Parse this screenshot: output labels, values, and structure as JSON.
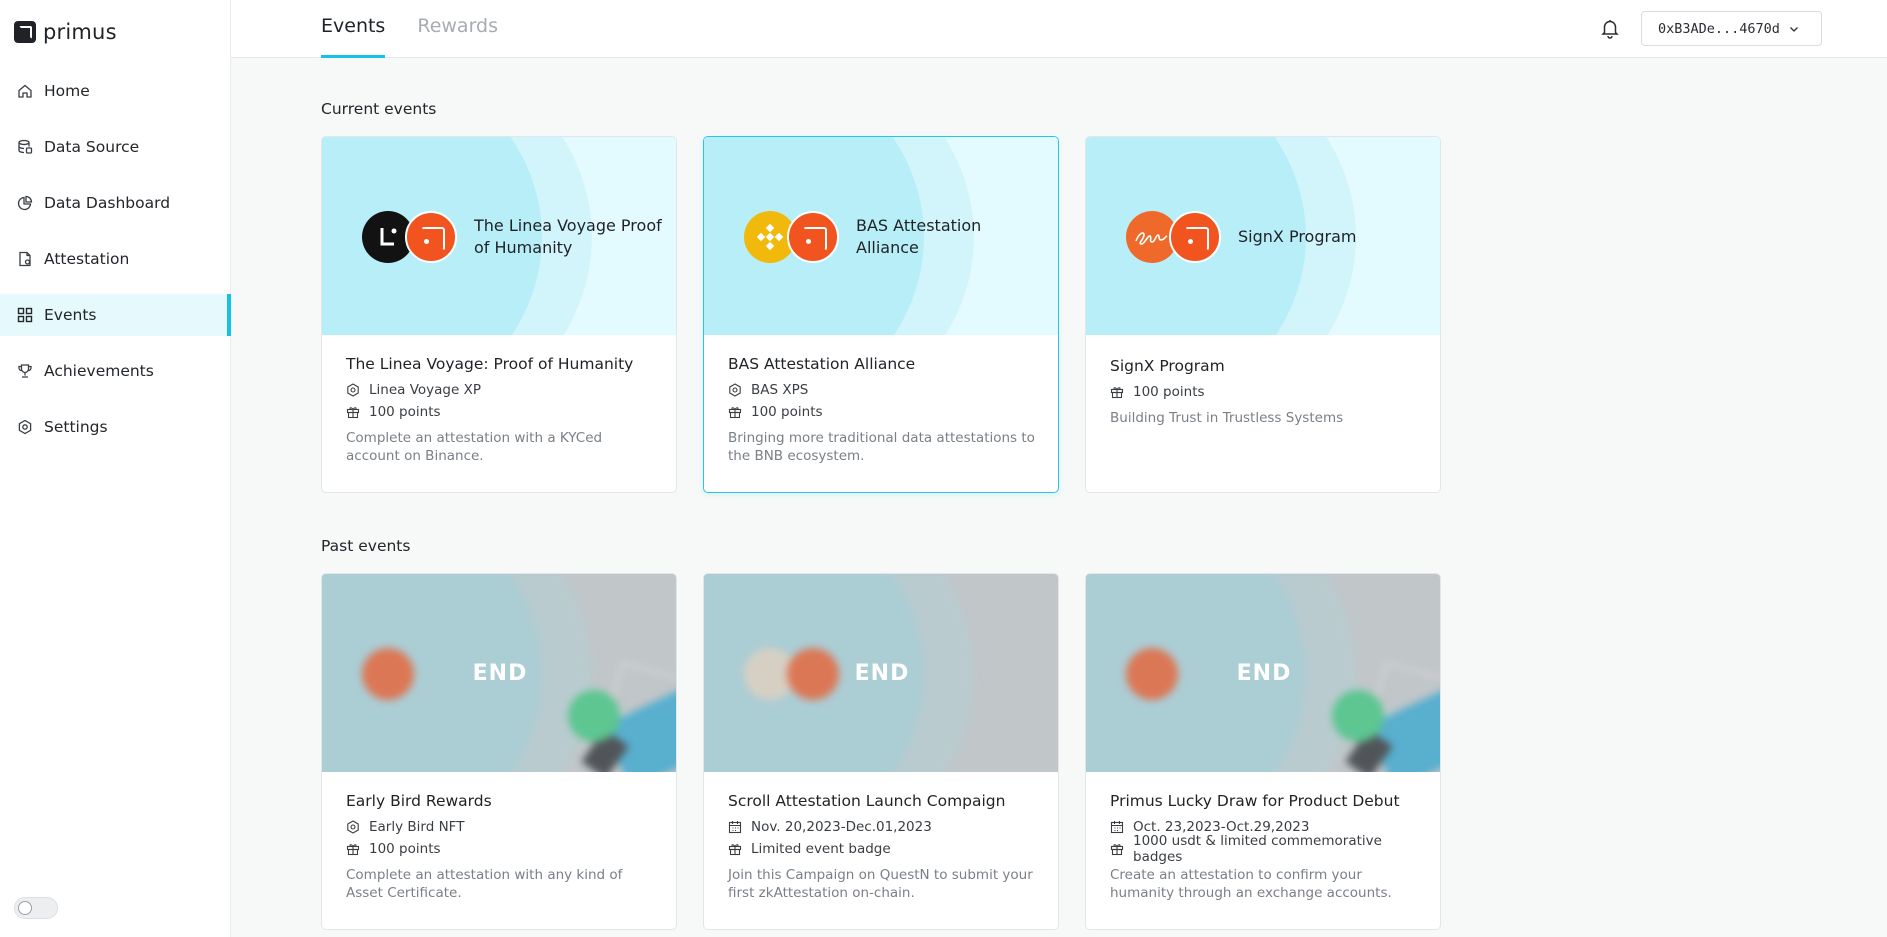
{
  "app": {
    "name": "primus"
  },
  "sidebar": {
    "items": [
      {
        "label": "Home",
        "icon": "home-icon"
      },
      {
        "label": "Data Source",
        "icon": "database-icon"
      },
      {
        "label": "Data Dashboard",
        "icon": "pie-chart-icon"
      },
      {
        "label": "Attestation",
        "icon": "document-icon"
      },
      {
        "label": "Events",
        "icon": "grid-icon",
        "active": true
      },
      {
        "label": "Achievements",
        "icon": "trophy-icon"
      },
      {
        "label": "Settings",
        "icon": "gear-icon"
      }
    ]
  },
  "header": {
    "tabs": [
      {
        "label": "Events",
        "active": true
      },
      {
        "label": "Rewards",
        "active": false
      }
    ],
    "wallet_address": "0xB3ADe...4670d"
  },
  "current": {
    "title": "Current events",
    "cards": [
      {
        "banner_title": "The Linea Voyage Proof of Humanity",
        "title": "The Linea Voyage: Proof of Humanity",
        "meta1_icon": "badge-icon",
        "meta1": "Linea Voyage XP",
        "meta2_icon": "gift-icon",
        "meta2": "100 points",
        "desc": "Complete an attestation with a KYCed account on Binance."
      },
      {
        "banner_title": "BAS Attestation Alliance",
        "title": "BAS Attestation Alliance",
        "meta1_icon": "badge-icon",
        "meta1": "BAS XPS",
        "meta2_icon": "gift-icon",
        "meta2": "100 points",
        "desc": "Bringing more traditional data attestations to the BNB ecosystem."
      },
      {
        "banner_title": "SignX Program",
        "title": "SignX Program",
        "meta1_icon": "gift-icon",
        "meta1": "100 points",
        "desc": "Building Trust in Trustless Systems"
      }
    ]
  },
  "past": {
    "title": "Past events",
    "end_label": "END",
    "cards": [
      {
        "title": "Early Bird Rewards",
        "meta1_icon": "badge-icon",
        "meta1": "Early Bird NFT",
        "meta2_icon": "gift-icon",
        "meta2": "100 points",
        "desc": "Complete an attestation with any kind of Asset Certificate."
      },
      {
        "title": "Scroll Attestation Launch Compaign",
        "meta1_icon": "calendar-icon",
        "meta1": "Nov. 20,2023-Dec.01,2023",
        "meta2_icon": "gift-icon",
        "meta2": "Limited event badge",
        "desc": "Join this Campaign on QuestN to submit your first zkAttestation on-chain."
      },
      {
        "title": "Primus Lucky Draw for Product Debut",
        "meta1_icon": "calendar-icon",
        "meta1": "Oct. 23,2023-Oct.29,2023",
        "meta2_icon": "gift-icon",
        "meta2": "1000 usdt & limited commemorative badges",
        "desc": "Create an attestation to confirm your humanity through an exchange accounts."
      }
    ]
  },
  "colors": {
    "accent": "#13c2e4",
    "brand_orange": "#f1541f"
  }
}
